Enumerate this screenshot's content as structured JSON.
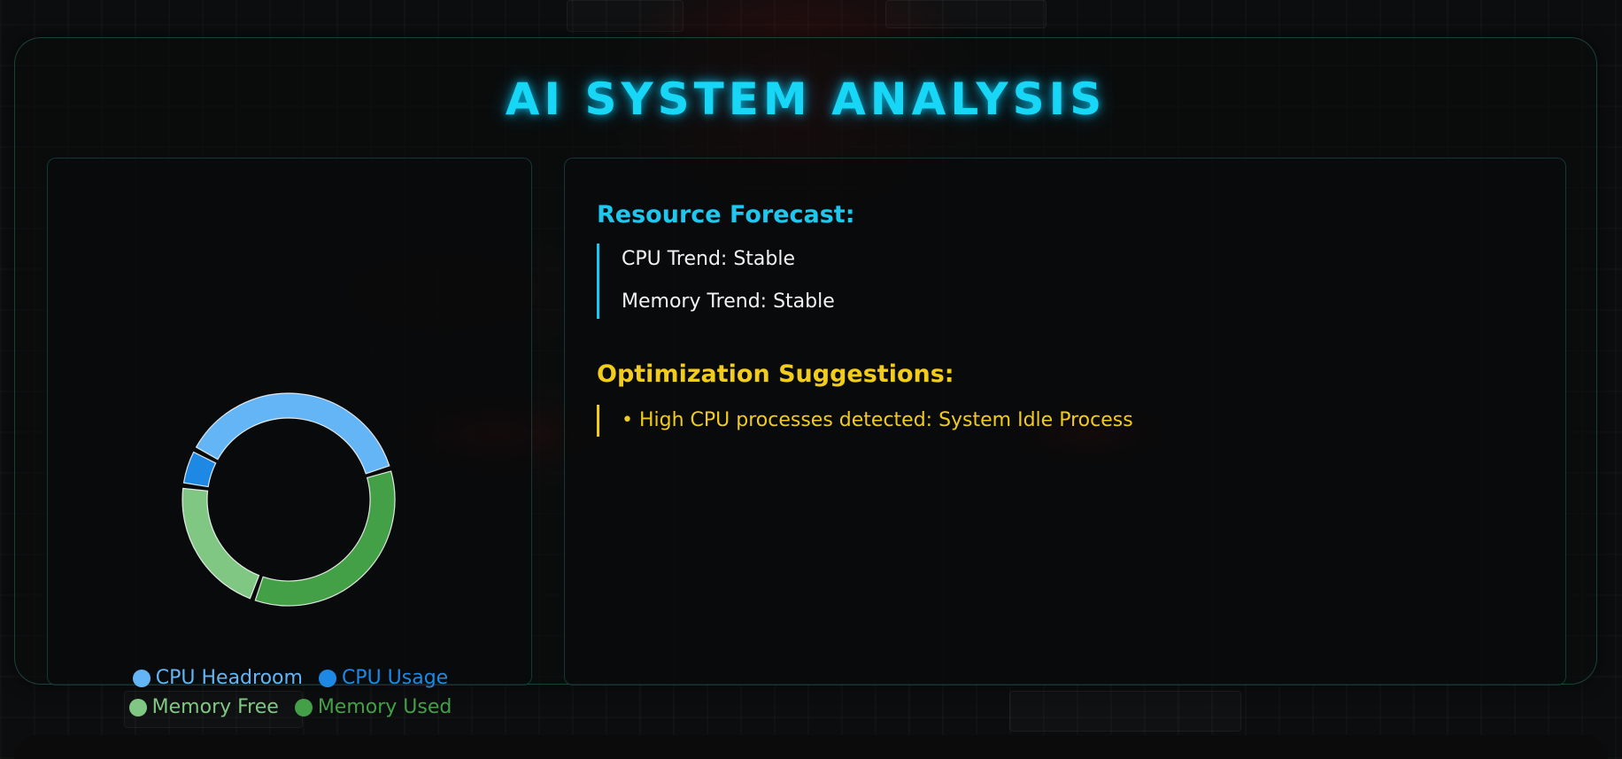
{
  "header": {
    "title": "AI SYSTEM ANALYSIS"
  },
  "chart_data": {
    "type": "pie",
    "variant": "donut",
    "series": [
      {
        "name": "CPU Headroom",
        "value": 0.33,
        "color": "#64b5f6"
      },
      {
        "name": "CPU Usage",
        "value": 0.05,
        "color": "#1e88e5"
      },
      {
        "name": "Memory Free",
        "value": 0.19,
        "color": "#81c784"
      },
      {
        "name": "Memory Used",
        "value": 0.31,
        "color": "#43a047"
      }
    ],
    "legend_placement": "bottom"
  },
  "legend": [
    {
      "label": "CPU Headroom",
      "color": "#64b5f6"
    },
    {
      "label": "CPU Usage",
      "color": "#1e88e5"
    },
    {
      "label": "Memory Free",
      "color": "#81c784"
    },
    {
      "label": "Memory Used",
      "color": "#43a047"
    }
  ],
  "forecast": {
    "title": "Resource Forecast:",
    "cpu_trend": "CPU Trend: Stable",
    "memory_trend": "Memory Trend: Stable",
    "accent_color": "#19c7f0"
  },
  "suggestions": {
    "title": "Optimization Suggestions:",
    "items": [
      "• High CPU processes detected: System Idle Process"
    ],
    "accent_color": "#f2cc1a"
  }
}
